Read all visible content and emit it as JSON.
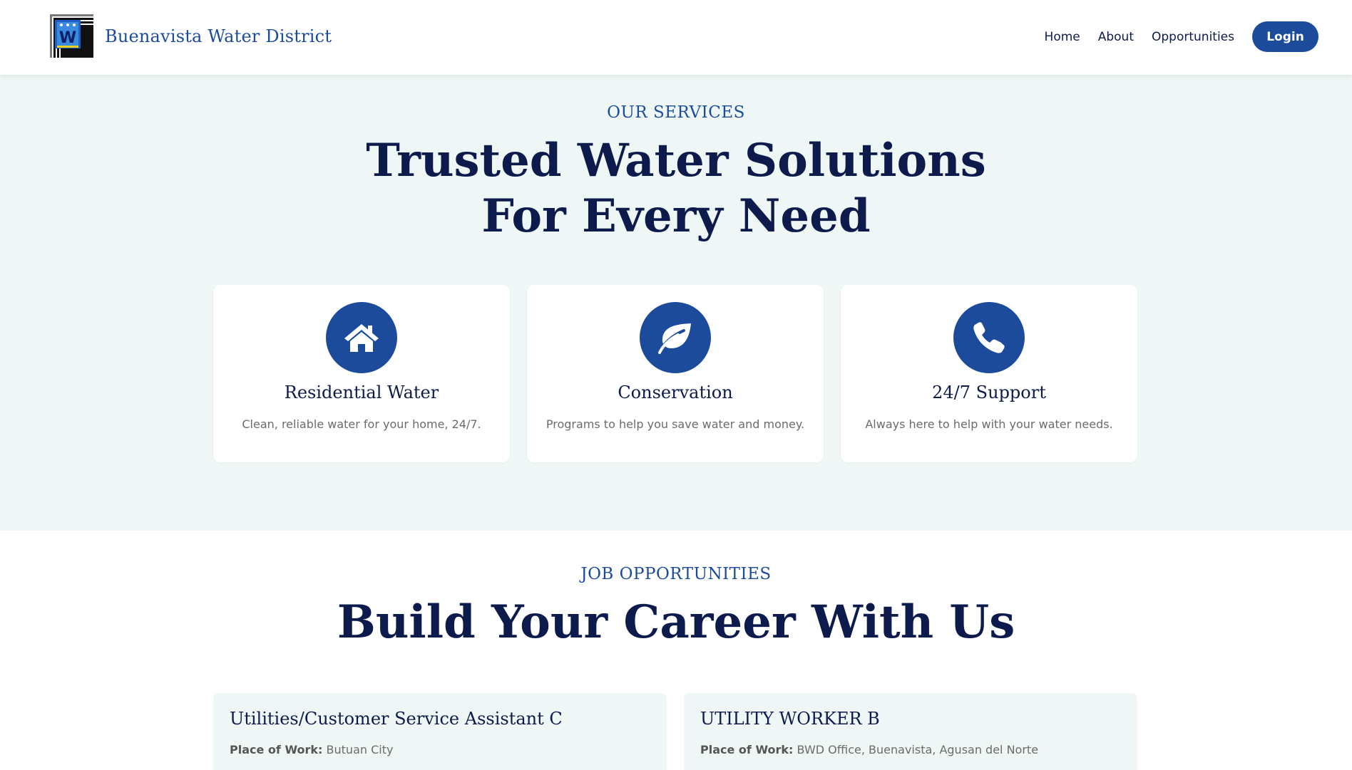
{
  "header": {
    "brand_name": "Buenavista Water District",
    "logo_icon": "water-district-logo-icon",
    "nav": [
      "Home",
      "About",
      "Opportunities"
    ],
    "login_label": "Login"
  },
  "services": {
    "eyebrow": "OUR SERVICES",
    "title_line1": "Trusted Water Solutions",
    "title_line2": "For Every Need",
    "cards": [
      {
        "icon": "home-icon",
        "title": "Residential Water",
        "desc": "Clean, reliable water for your home, 24/7."
      },
      {
        "icon": "leaf-icon",
        "title": "Conservation",
        "desc": "Programs to help you save water and money."
      },
      {
        "icon": "phone-icon",
        "title": "24/7 Support",
        "desc": "Always here to help with your water needs."
      }
    ]
  },
  "jobs": {
    "eyebrow": "JOB OPPORTUNITIES",
    "title": "Build Your Career With Us",
    "place_label": "Place of Work:",
    "items": [
      {
        "title": "Utilities/Customer Service Assistant C",
        "place": "Butuan City"
      },
      {
        "title": "UTILITY WORKER B",
        "place": "BWD Office, Buenavista, Agusan del Norte"
      }
    ]
  },
  "colors": {
    "primary": "#1c4b9c",
    "heading": "#0d1b4c",
    "section_bg": "#eef7f6"
  }
}
